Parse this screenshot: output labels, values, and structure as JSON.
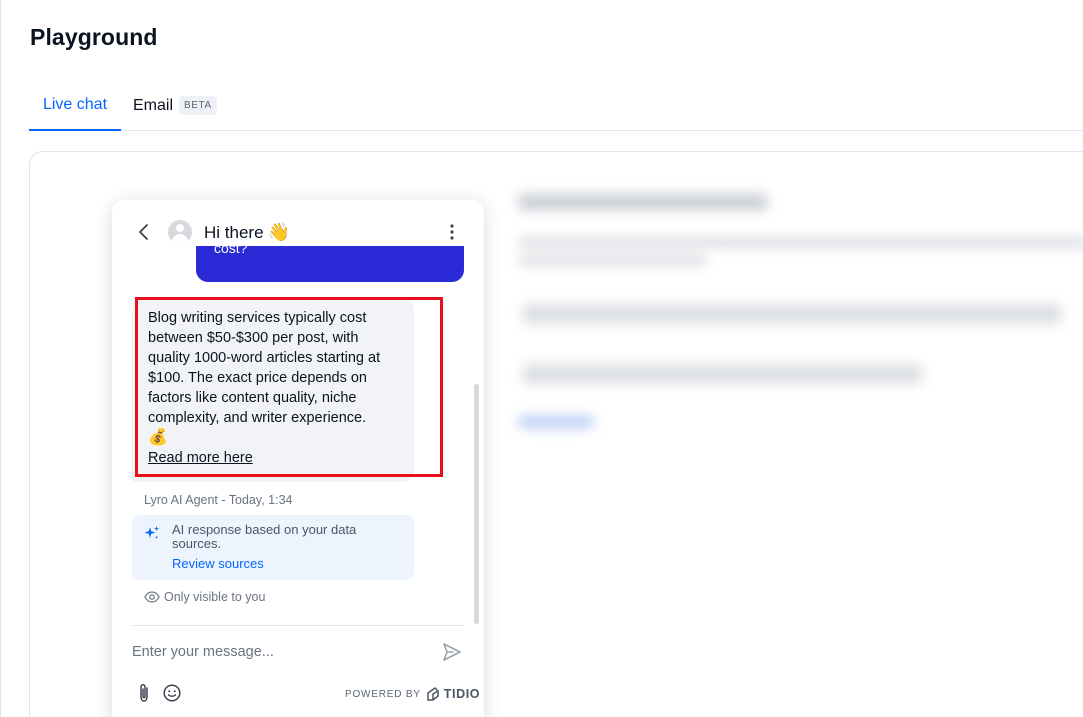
{
  "page": {
    "title": "Playground"
  },
  "tabs": [
    {
      "label": "Live chat",
      "active": true
    },
    {
      "label": "Email",
      "badge": "BETA",
      "active": false
    }
  ],
  "colors": {
    "accent": "#0566ff",
    "user_bubble": "#2a2bd6",
    "highlight": "#e8101a"
  },
  "chat": {
    "header_title": "Hi there",
    "header_emoji": "👋",
    "user_message_fragment": "cost?",
    "bot_message": "Blog writing services typically cost between $50-$300 per post, with quality 1000-word articles starting at $100. The exact price depends on factors like content quality, niche complexity, and writer experience.",
    "bot_emoji": "💰",
    "read_more_label": "Read more here",
    "meta": "Lyro AI Agent - Today, 1:34",
    "ai_notice": "AI response based on your data sources.",
    "review_sources_label": "Review sources",
    "visibility_note": "Only visible to you",
    "input_placeholder": "Enter your message...",
    "powered_by": "POWERED BY",
    "brand": "TIDIO"
  },
  "icons": {
    "back": "chevron-left-icon",
    "menu": "more-vertical-icon",
    "sparkle": "sparkle-icon",
    "visibility": "eye-icon",
    "send": "send-icon",
    "attach": "paperclip-icon",
    "emoji": "emoji-icon",
    "brand": "tidio-logo-icon"
  }
}
